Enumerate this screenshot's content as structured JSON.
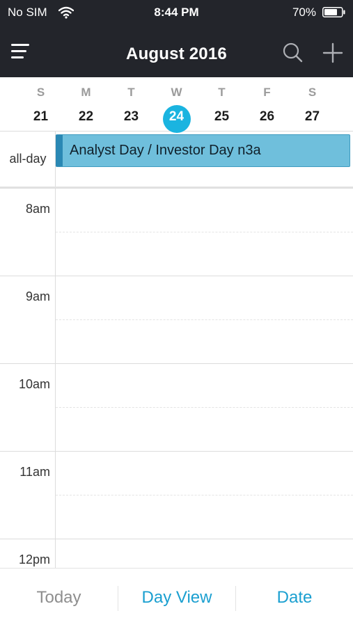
{
  "status_bar": {
    "carrier": "No SIM",
    "time": "8:44 PM",
    "battery": "70%"
  },
  "header": {
    "title": "August 2016"
  },
  "icons": {
    "menu": "hamburger-icon",
    "search": "search-icon",
    "add": "plus-icon"
  },
  "week": {
    "days": [
      {
        "dow": "S",
        "num": "21"
      },
      {
        "dow": "M",
        "num": "22"
      },
      {
        "dow": "T",
        "num": "23"
      },
      {
        "dow": "W",
        "num": "24",
        "selected": true
      },
      {
        "dow": "T",
        "num": "25"
      },
      {
        "dow": "F",
        "num": "26"
      },
      {
        "dow": "S",
        "num": "27"
      }
    ]
  },
  "allday": {
    "label": "all-day",
    "event": "Analyst Day / Investor Day n3a"
  },
  "timeline": {
    "hours": [
      "8am",
      "9am",
      "10am",
      "11am",
      "12pm"
    ]
  },
  "toolbar": {
    "today": "Today",
    "day_view": "Day View",
    "date": "Date"
  },
  "colors": {
    "header_bg": "#23252b",
    "accent": "#1ab4e0",
    "event_fill": "#6fbfdc",
    "event_bar": "#2a88b4",
    "toolbar_inactive": "#8e8e8e",
    "toolbar_active": "#1a9fd0"
  }
}
